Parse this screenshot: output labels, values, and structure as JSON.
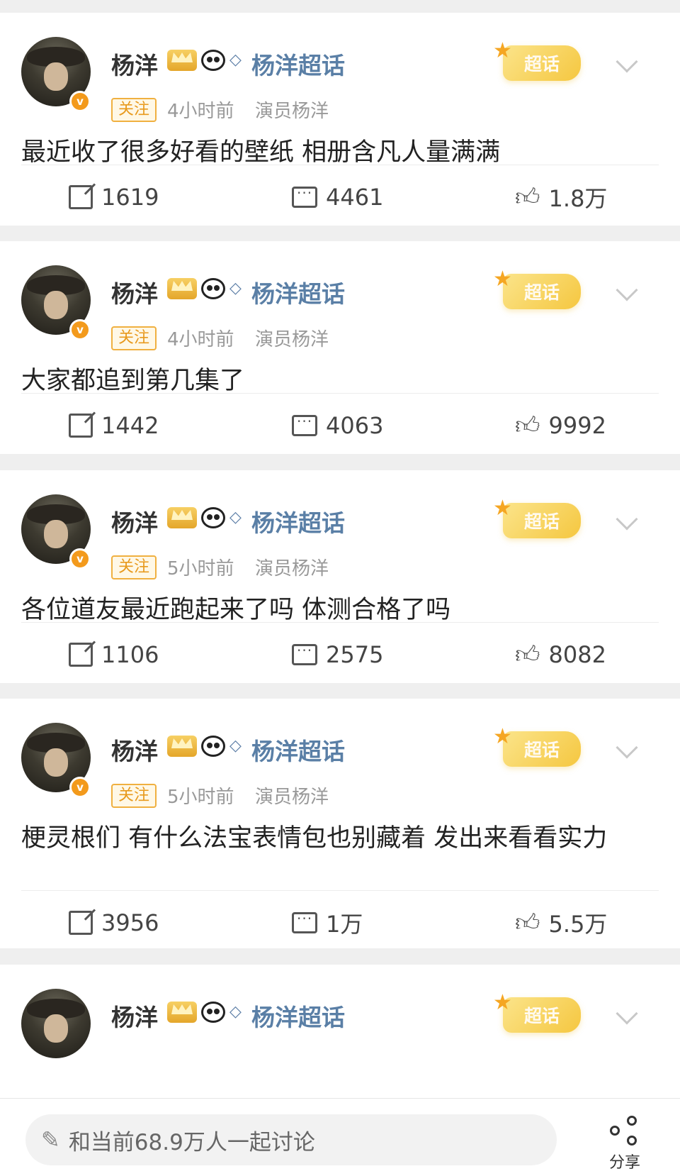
{
  "posts": [
    {
      "user": "杨洋",
      "topic": "杨洋超话",
      "super_badge": "超话",
      "follow": "关注",
      "time": "4小时前",
      "source": "演员杨洋",
      "text": "最近收了很多好看的壁纸 相册含凡人量满满",
      "reposts": "1619",
      "comments": "4461",
      "likes": "1.8万"
    },
    {
      "user": "杨洋",
      "topic": "杨洋超话",
      "super_badge": "超话",
      "follow": "关注",
      "time": "4小时前",
      "source": "演员杨洋",
      "text": "大家都追到第几集了",
      "reposts": "1442",
      "comments": "4063",
      "likes": "9992"
    },
    {
      "user": "杨洋",
      "topic": "杨洋超话",
      "super_badge": "超话",
      "follow": "关注",
      "time": "5小时前",
      "source": "演员杨洋",
      "text": "各位道友最近跑起来了吗 体测合格了吗",
      "reposts": "1106",
      "comments": "2575",
      "likes": "8082"
    },
    {
      "user": "杨洋",
      "topic": "杨洋超话",
      "super_badge": "超话",
      "follow": "关注",
      "time": "5小时前",
      "source": "演员杨洋",
      "text": "梗灵根们 有什么法宝表情包也别藏着 发出来看看实力",
      "reposts": "3956",
      "comments": "1万",
      "likes": "5.5万"
    },
    {
      "user": "杨洋",
      "topic": "杨洋超话",
      "super_badge": "超话"
    }
  ],
  "bottom_bar": {
    "discuss_placeholder": "和当前68.9万人一起讨论",
    "share_label": "分享"
  },
  "colors": {
    "topic_blue": "#5a7fa6",
    "follow_orange": "#e89a1e",
    "verified_orange": "#f39a1c",
    "super_badge_yellow": "#f5c740"
  }
}
